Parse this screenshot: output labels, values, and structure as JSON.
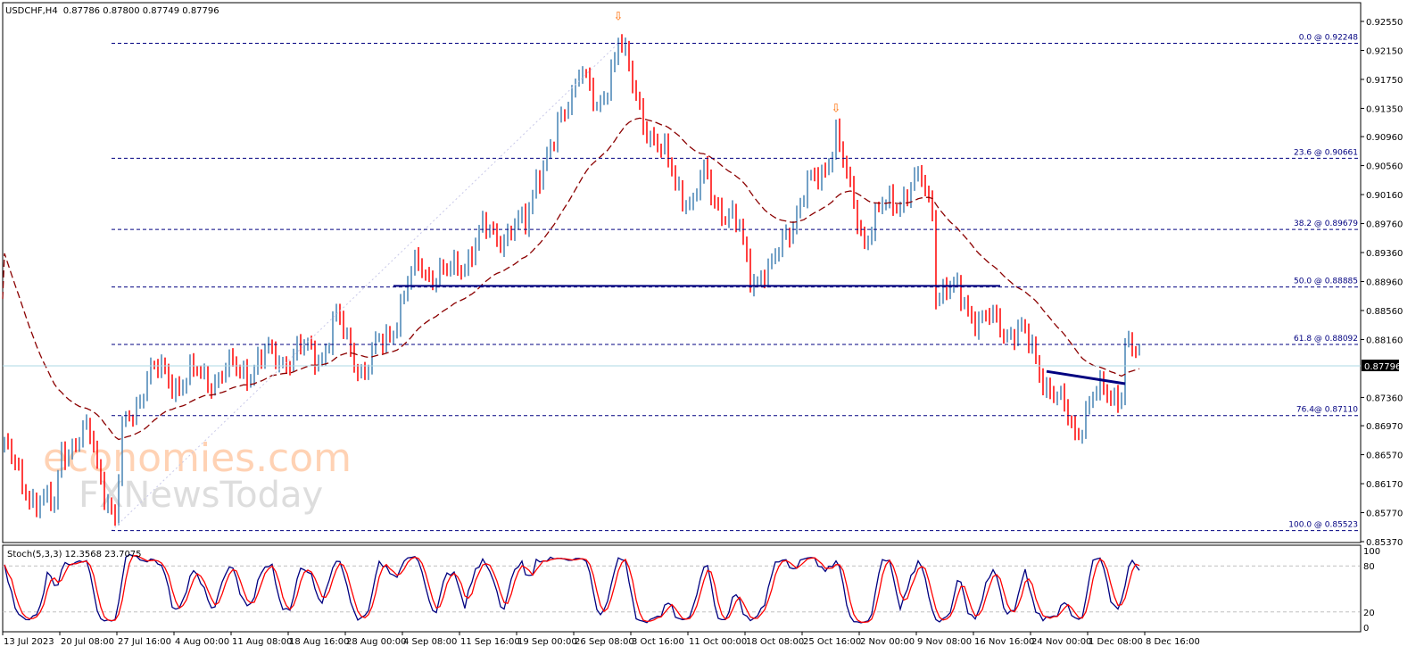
{
  "header": {
    "symbol": "USDCHF,H4",
    "ohlc": "0.87786 0.87800 0.87749 0.87796"
  },
  "colors": {
    "up": "#4682B4",
    "down": "#FF0000",
    "ma": "#8B0000",
    "fibo": "#000080",
    "current": "#ADD8E6",
    "stoch_main": "#000080",
    "stoch_signal": "#FF0000",
    "arrow": "#FF6A00"
  },
  "watermark": {
    "line1": "economies.com",
    "line2": "FXNewsToday"
  },
  "current_price": {
    "value": 0.87796,
    "label": "0.87796"
  },
  "stoch": {
    "label": "Stoch(5,3,3) 12.3568 23.7075",
    "levels": [
      "100",
      "80",
      "20",
      "0"
    ]
  },
  "chart_data": {
    "type": "ohlc",
    "title": "USDCHF,H4",
    "ylim": [
      0.8537,
      0.9255
    ],
    "y_ticks": [
      "0.92550",
      "0.92150",
      "0.91750",
      "0.91350",
      "0.90960",
      "0.90560",
      "0.90160",
      "0.89760",
      "0.89360",
      "0.88960",
      "0.88560",
      "0.88160",
      "0.87360",
      "0.86970",
      "0.86570",
      "0.86170",
      "0.85770",
      "0.85370"
    ],
    "x_ticks": [
      "13 Jul 2023",
      "20 Jul 08:00",
      "27 Jul 16:00",
      "4 Aug 00:00",
      "11 Aug 08:00",
      "18 Aug 16:00",
      "28 Aug 00:00",
      "4 Sep 08:00",
      "11 Sep 16:00",
      "19 Sep 00:00",
      "26 Sep 08:00",
      "3 Oct 16:00",
      "11 Oct 00:00",
      "18 Oct 08:00",
      "25 Oct 16:00",
      "2 Nov 00:00",
      "9 Nov 08:00",
      "16 Nov 16:00",
      "24 Nov 00:00",
      "1 Dec 08:00",
      "8 Dec 16:00"
    ],
    "bar_count": 319,
    "close_path": [
      [
        0,
        0.867
      ],
      [
        4,
        0.862
      ],
      [
        14,
        0.8578
      ],
      [
        16,
        0.867
      ],
      [
        24,
        0.868
      ],
      [
        29,
        0.86
      ],
      [
        31,
        0.856
      ],
      [
        33,
        0.868
      ],
      [
        40,
        0.877
      ],
      [
        49,
        0.876
      ],
      [
        64,
        0.877
      ],
      [
        74,
        0.879
      ],
      [
        89,
        0.88
      ],
      [
        93,
        0.884
      ],
      [
        101,
        0.877
      ],
      [
        109,
        0.884
      ],
      [
        116,
        0.892
      ],
      [
        124,
        0.89
      ],
      [
        134,
        0.896
      ],
      [
        146,
        0.897
      ],
      [
        149,
        0.905
      ],
      [
        154,
        0.908
      ],
      [
        161,
        0.92
      ],
      [
        166,
        0.912
      ],
      [
        172,
        0.9235
      ],
      [
        176,
        0.916
      ],
      [
        184,
        0.907
      ],
      [
        193,
        0.9
      ],
      [
        196,
        0.904
      ],
      [
        206,
        0.896
      ],
      [
        209,
        0.891
      ],
      [
        215,
        0.8905
      ],
      [
        219,
        0.897
      ],
      [
        229,
        0.905
      ],
      [
        233,
        0.91
      ],
      [
        236,
        0.903
      ],
      [
        241,
        0.896
      ],
      [
        249,
        0.901
      ],
      [
        257,
        0.903
      ],
      [
        260,
        0.9
      ],
      [
        261,
        0.889
      ],
      [
        269,
        0.887
      ],
      [
        274,
        0.884
      ],
      [
        284,
        0.883
      ],
      [
        291,
        0.877
      ],
      [
        296,
        0.872
      ],
      [
        300,
        0.869
      ],
      [
        304,
        0.873
      ],
      [
        313,
        0.875
      ],
      [
        314,
        0.881
      ],
      [
        318,
        0.878
      ]
    ],
    "fibonacci": [
      {
        "level": "0.0",
        "price": 0.92248,
        "label": "0.0 @ 0.92248"
      },
      {
        "level": "23.6",
        "price": 0.90661,
        "label": "23.6 @ 0.90661"
      },
      {
        "level": "38.2",
        "price": 0.89679,
        "label": "38.2 @ 0.89679"
      },
      {
        "level": "50.0",
        "price": 0.88885,
        "label": "50.0 @ 0.88885"
      },
      {
        "level": "61.8",
        "price": 0.88092,
        "label": "61.8 @ 0.88092"
      },
      {
        "level": "76.4",
        "price": 0.8711,
        "label": "76.4@ 0.87110"
      },
      {
        "level": "100.0",
        "price": 0.85523,
        "label": "100.0 @ 0.85523"
      }
    ],
    "neckline": {
      "price": 0.889,
      "from_bar": 109,
      "to_bar": 279
    },
    "trendline": {
      "from": [
        292,
        0.8772
      ],
      "to": [
        314,
        0.8755
      ]
    },
    "top_arrows": [
      [
        172,
        0.9262
      ],
      [
        233,
        0.9135
      ]
    ],
    "ma_seed": 0.895
  }
}
